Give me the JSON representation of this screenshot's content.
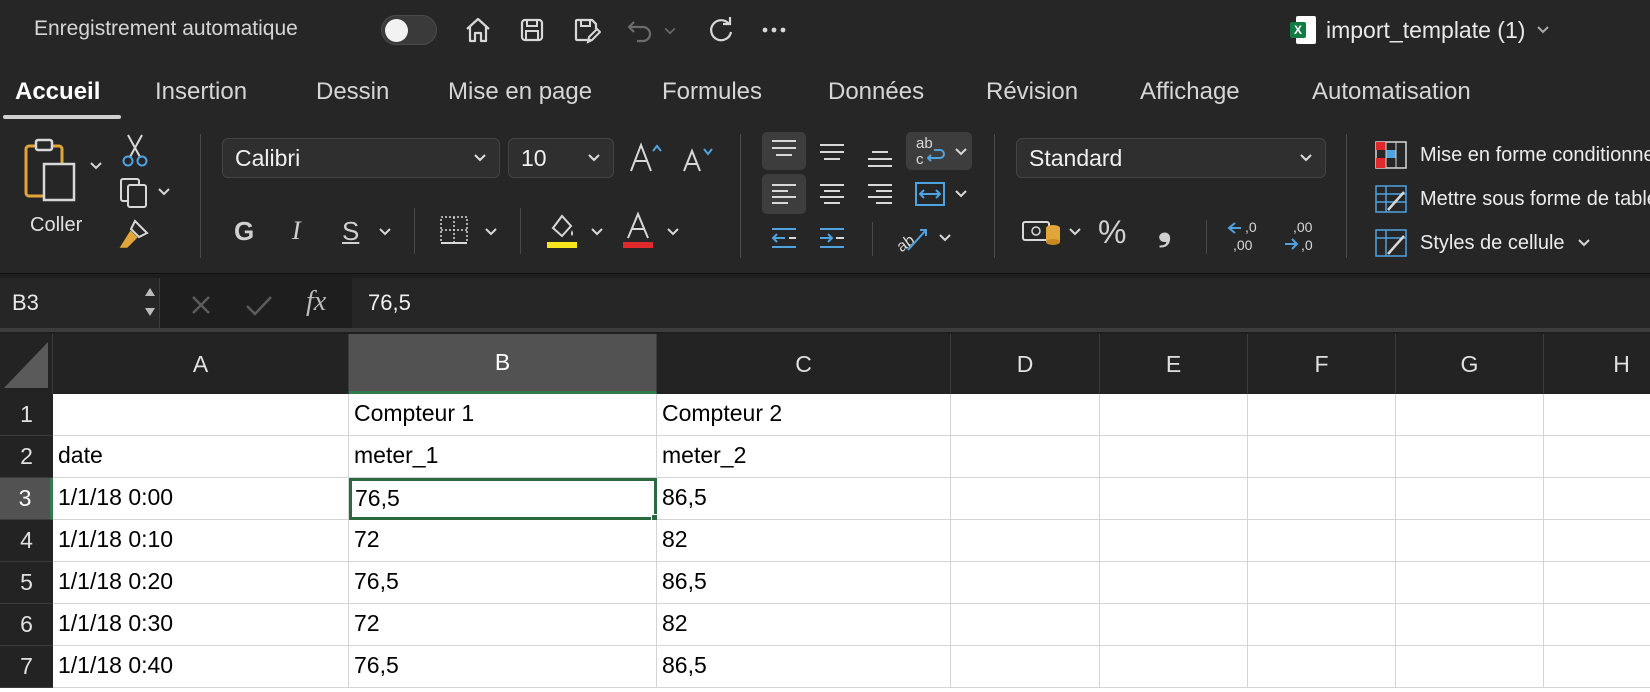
{
  "titlebar": {
    "autosave_label": "Enregistrement automatique",
    "autosave_on": false,
    "icons": [
      "home-icon",
      "save-icon",
      "save-as-icon",
      "undo-icon",
      "redo-icon",
      "more-icon"
    ],
    "doc_title": "import_template (1)"
  },
  "tabs": [
    "Accueil",
    "Insertion",
    "Dessin",
    "Mise en page",
    "Formules",
    "Données",
    "Révision",
    "Affichage",
    "Automatisation"
  ],
  "ribbon": {
    "paste_label": "Coller",
    "font_name": "Calibri",
    "font_size": "10",
    "bold": "G",
    "italic": "I",
    "strike": "S",
    "number_format": "Standard",
    "percent": "%",
    "comma": "❟",
    "increase_decimal": ",00",
    "decrease_decimal": ",00",
    "styles": {
      "conditional": "Mise en forme conditionnelle",
      "table": "Mettre sous forme de tableau",
      "cell": "Styles de cellule"
    },
    "colors": {
      "highlight": "#f5e51a",
      "font_color": "#e0292b"
    }
  },
  "formula_bar": {
    "name_box": "B3",
    "fx": "fx",
    "value": "76,5"
  },
  "grid": {
    "columns": [
      "A",
      "B",
      "C",
      "D",
      "E",
      "F",
      "G",
      "H"
    ],
    "selected_column": "B",
    "selected_row": "3",
    "rows": [
      {
        "num": "1",
        "cells": [
          "",
          "Compteur 1",
          "Compteur 2"
        ]
      },
      {
        "num": "2",
        "cells": [
          "date",
          "meter_1",
          "meter_2"
        ]
      },
      {
        "num": "3",
        "cells": [
          "1/1/18 0:00",
          "76,5",
          "86,5"
        ]
      },
      {
        "num": "4",
        "cells": [
          "1/1/18 0:10",
          "72",
          "82"
        ]
      },
      {
        "num": "5",
        "cells": [
          "1/1/18 0:20",
          "76,5",
          "86,5"
        ]
      },
      {
        "num": "6",
        "cells": [
          "1/1/18 0:30",
          "72",
          "82"
        ]
      },
      {
        "num": "7",
        "cells": [
          "1/1/18 0:40",
          "76,5",
          "86,5"
        ]
      }
    ]
  }
}
